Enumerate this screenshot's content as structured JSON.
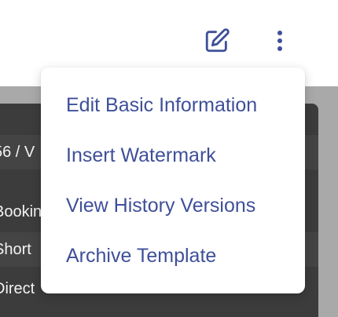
{
  "header": {
    "edit_icon": "edit-pencil-square-icon",
    "more_icon": "more-vertical-dots-icon",
    "accent_color": "#3f4f99"
  },
  "panel": {
    "rows": [
      {
        "text": "56 / V"
      },
      {
        "text": "Bookin"
      },
      {
        "text": "Short"
      },
      {
        "text": "Direct"
      }
    ]
  },
  "menu": {
    "items": [
      {
        "label": "Edit Basic Information"
      },
      {
        "label": "Insert Watermark"
      },
      {
        "label": "View History Versions"
      },
      {
        "label": "Archive Template"
      }
    ]
  }
}
